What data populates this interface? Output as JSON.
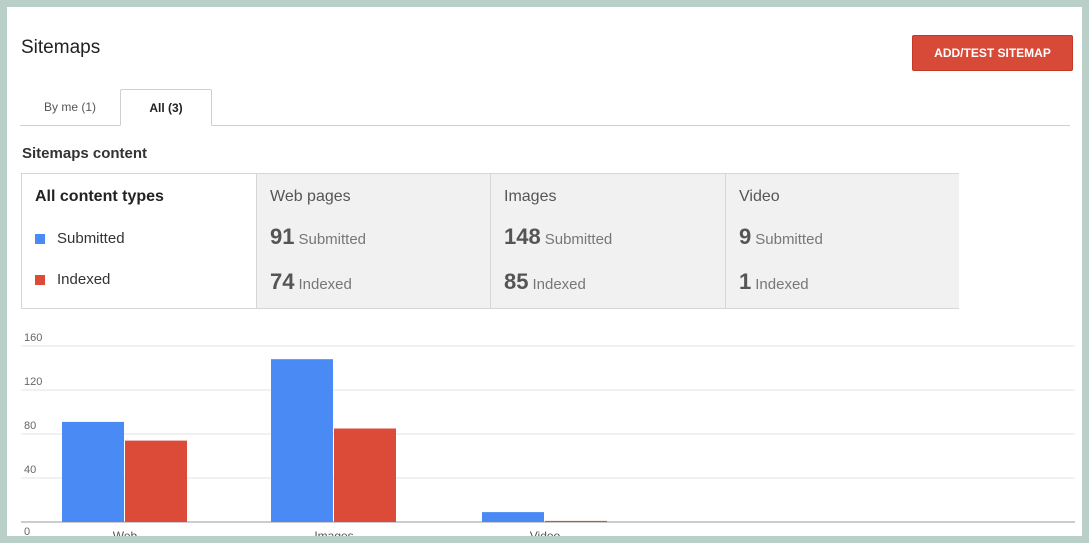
{
  "page": {
    "title": "Sitemaps",
    "add_button": "ADD/TEST SITEMAP",
    "tabs": [
      {
        "label": "By me (1)",
        "active": false
      },
      {
        "label": "All (3)",
        "active": true
      }
    ],
    "section_title": "Sitemaps content"
  },
  "panels": {
    "legend": {
      "heading": "All content types",
      "submitted_label": "Submitted",
      "indexed_label": "Indexed",
      "submitted_color": "#4a8af4",
      "indexed_color": "#dc4a38"
    },
    "stats": [
      {
        "heading": "Web pages",
        "submitted": "91",
        "submitted_label": "Submitted",
        "indexed": "74",
        "indexed_label": "Indexed"
      },
      {
        "heading": "Images",
        "submitted": "148",
        "submitted_label": "Submitted",
        "indexed": "85",
        "indexed_label": "Indexed"
      },
      {
        "heading": "Video",
        "submitted": "9",
        "submitted_label": "Submitted",
        "indexed": "1",
        "indexed_label": "Indexed"
      }
    ]
  },
  "chart_data": {
    "type": "bar",
    "categories": [
      "Web",
      "Images",
      "Video"
    ],
    "series": [
      {
        "name": "Submitted",
        "values": [
          91,
          148,
          9
        ],
        "color": "#4a8af4"
      },
      {
        "name": "Indexed",
        "values": [
          74,
          85,
          1
        ],
        "color": "#dc4a38"
      }
    ],
    "yticks": [
      "0",
      "40",
      "80",
      "120",
      "160"
    ],
    "ylim": [
      0,
      160
    ],
    "grid": true,
    "legend": "none"
  }
}
